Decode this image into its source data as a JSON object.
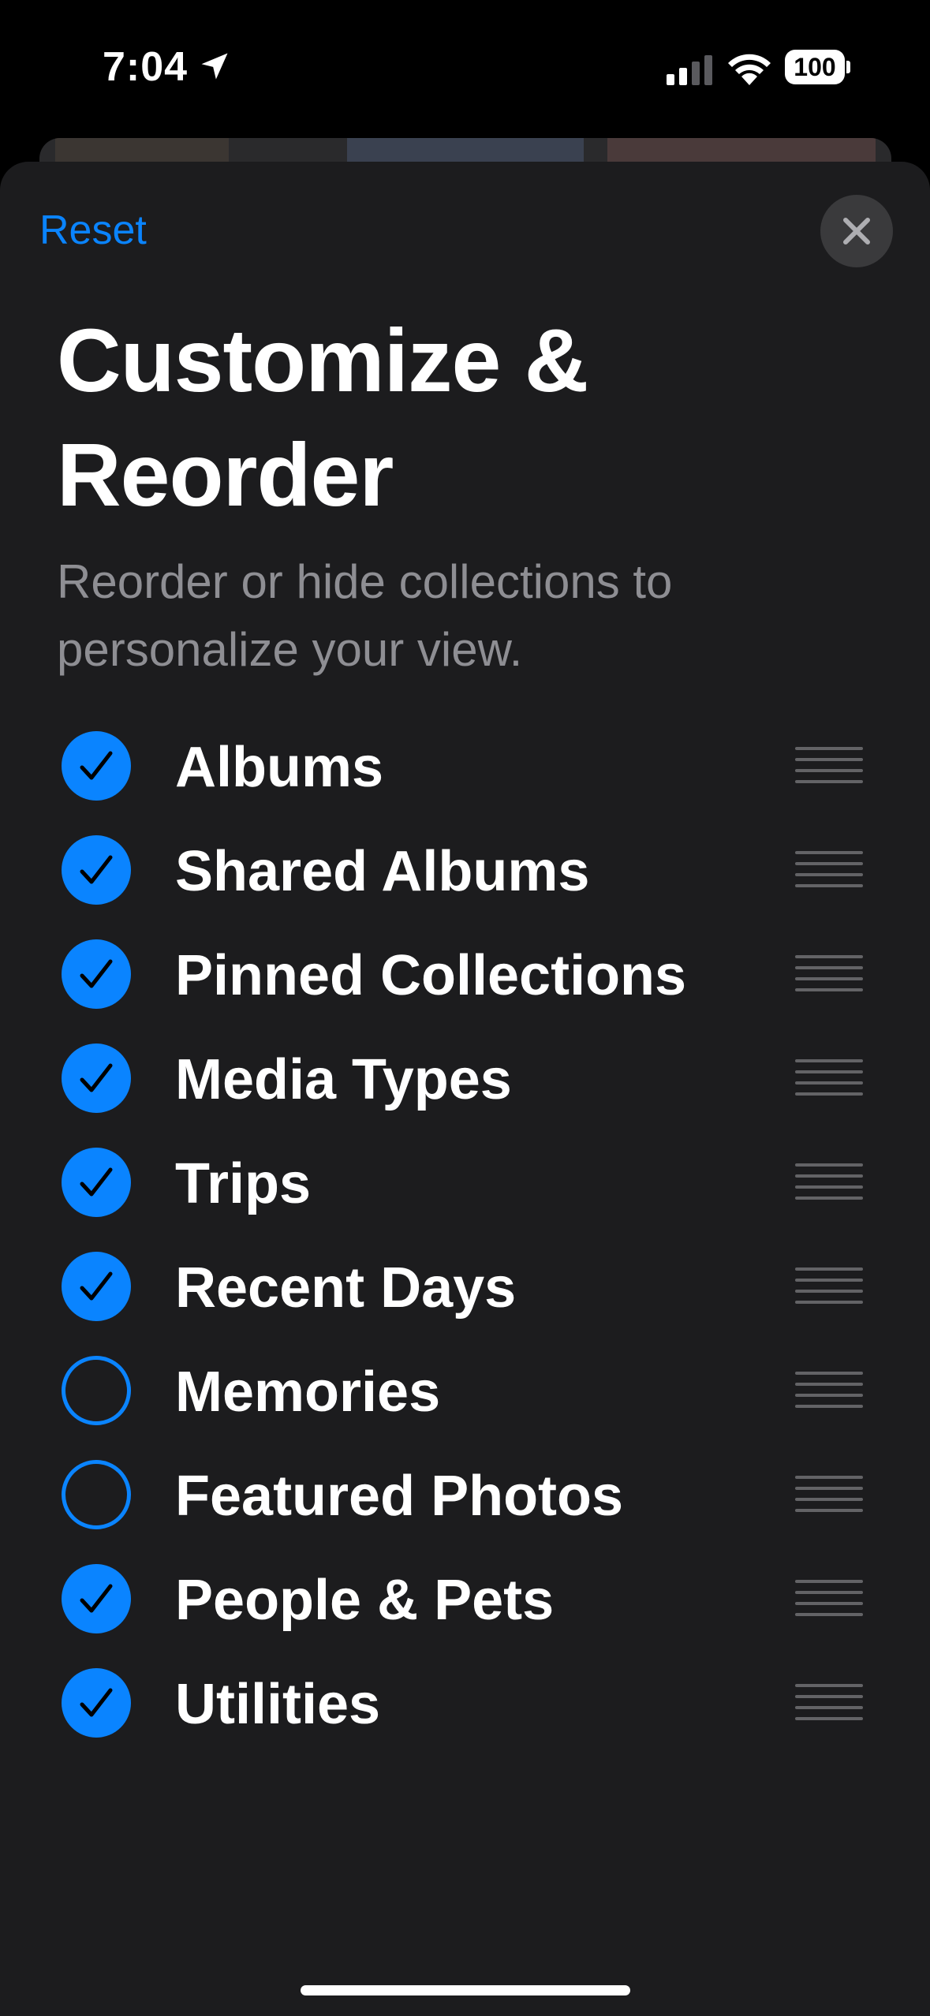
{
  "status_bar": {
    "time": "7:04",
    "battery": "100",
    "icons": [
      "location-arrow-icon",
      "cellular-signal-icon",
      "wifi-icon",
      "battery-icon"
    ]
  },
  "sheet": {
    "reset_label": "Reset",
    "close_icon": "close-icon",
    "title": "Customize & Reorder",
    "subtitle": "Reorder or hide collections to personalize your view."
  },
  "items": [
    {
      "label": "Albums",
      "checked": true
    },
    {
      "label": "Shared Albums",
      "checked": true
    },
    {
      "label": "Pinned Collections",
      "checked": true
    },
    {
      "label": "Media Types",
      "checked": true
    },
    {
      "label": "Trips",
      "checked": true
    },
    {
      "label": "Recent Days",
      "checked": true
    },
    {
      "label": "Memories",
      "checked": false
    },
    {
      "label": "Featured Photos",
      "checked": false
    },
    {
      "label": "People & Pets",
      "checked": true
    },
    {
      "label": "Utilities",
      "checked": true
    }
  ],
  "colors": {
    "accent": "#0a84ff",
    "sheet_background": "#1c1c1e",
    "secondary_text": "#8e8e93",
    "handle": "#636366"
  }
}
